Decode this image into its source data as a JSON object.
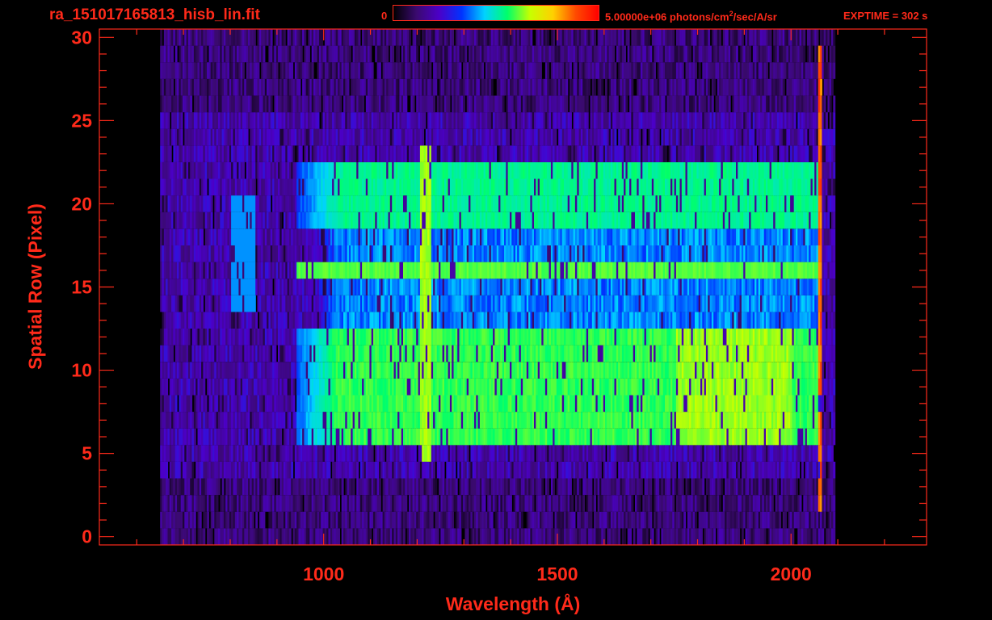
{
  "header": {
    "file_title": "ra_151017165813_hisb_lin.fit",
    "colorbar_min": "0",
    "colorbar_max_value": "5.00000e+06 photons/cm",
    "colorbar_max_exponent": "2",
    "colorbar_max_suffix": "/sec/A/sr",
    "exptime": "EXPTIME = 302 s"
  },
  "colors": {
    "axis": "#ff2a1a",
    "background": "#000000",
    "colormap": [
      "#000000",
      "#3a0a6e",
      "#4b00c8",
      "#0033ff",
      "#00d2ff",
      "#00ff6a",
      "#c8ff00",
      "#ffd000",
      "#ff4a00",
      "#ff0000"
    ]
  },
  "chart_data": {
    "type": "heatmap",
    "title": "ra_151017165813_hisb_lin.fit",
    "xlabel": "Wavelength (Å)",
    "ylabel": "Spatial Row (Pixel)",
    "xlim": [
      520,
      2290
    ],
    "ylim": [
      -0.5,
      30.5
    ],
    "x_ticks": [
      1000,
      1500,
      2000
    ],
    "y_ticks": [
      0,
      5,
      10,
      15,
      20,
      25,
      30
    ],
    "colorbar": {
      "min": 0,
      "max": 5000000,
      "units": "photons/cm^2/sec/A/sr"
    },
    "emission_x_range": [
      680,
      2060
    ],
    "features": [
      {
        "name": "bright band",
        "rows": [
          6,
          12
        ],
        "x_start": 940,
        "x_end": 2060,
        "level": 0.55
      },
      {
        "name": "bright band",
        "rows": [
          19,
          22
        ],
        "x_start": 940,
        "x_end": 2060,
        "level": 0.5
      },
      {
        "name": "bright stripe",
        "rows": [
          16,
          16
        ],
        "x_start": 940,
        "x_end": 2060,
        "level": 0.58
      },
      {
        "name": "medium band",
        "rows": [
          13,
          18
        ],
        "x_start": 940,
        "x_end": 2060,
        "level": 0.33
      },
      {
        "name": "emission line",
        "x": 1216,
        "rows": [
          5,
          23
        ],
        "level": 0.62
      },
      {
        "name": "detector edge",
        "x": 2060,
        "rows": [
          2,
          29
        ],
        "level": 0.82
      },
      {
        "name": "arc feature",
        "x_start": 800,
        "x_end": 850,
        "rows": [
          14,
          20
        ],
        "level": 0.4
      }
    ]
  }
}
